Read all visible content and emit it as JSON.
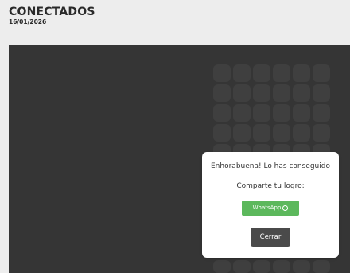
{
  "header": {
    "title": "CONECTADOS",
    "date": "16/01/2026"
  },
  "board": {
    "rows_visible": 5,
    "columns": 6
  },
  "modal": {
    "title": "Enhorabuena! Lo has conseguido",
    "share_prompt": "Comparte tu logro:",
    "whatsapp_label": "WhatsApp",
    "whatsapp_icon": "whatsapp-icon",
    "close_label": "Cerrar"
  },
  "colors": {
    "background": "#ededed",
    "board_bg": "#353535",
    "tile": "#3f3f3f",
    "whatsapp_green": "#5cb85c",
    "close_btn": "#4a4a4a"
  }
}
